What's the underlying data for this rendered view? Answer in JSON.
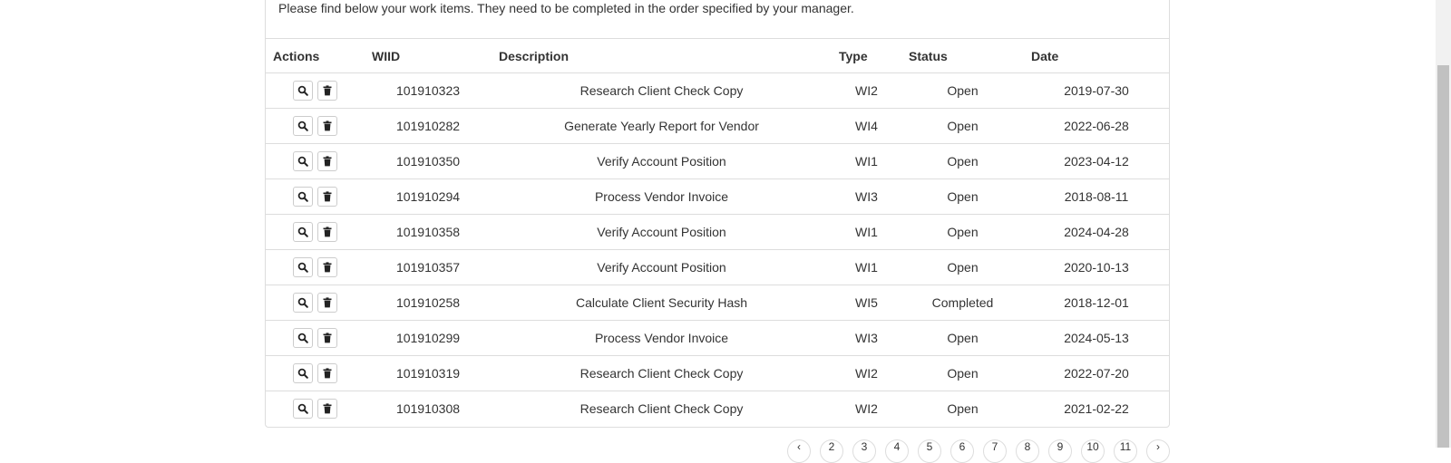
{
  "intro_text": "Please find below your work items. They need to be completed in the order specified by your manager.",
  "table": {
    "headers": [
      "Actions",
      "WIID",
      "Description",
      "Type",
      "Status",
      "Date"
    ],
    "rows": [
      {
        "wiid": "101910323",
        "description": "Research Client Check Copy",
        "type": "WI2",
        "status": "Open",
        "date": "2019-07-30"
      },
      {
        "wiid": "101910282",
        "description": "Generate Yearly Report for Vendor",
        "type": "WI4",
        "status": "Open",
        "date": "2022-06-28"
      },
      {
        "wiid": "101910350",
        "description": "Verify Account Position",
        "type": "WI1",
        "status": "Open",
        "date": "2023-04-12"
      },
      {
        "wiid": "101910294",
        "description": "Process Vendor Invoice",
        "type": "WI3",
        "status": "Open",
        "date": "2018-08-11"
      },
      {
        "wiid": "101910358",
        "description": "Verify Account Position",
        "type": "WI1",
        "status": "Open",
        "date": "2024-04-28"
      },
      {
        "wiid": "101910357",
        "description": "Verify Account Position",
        "type": "WI1",
        "status": "Open",
        "date": "2020-10-13"
      },
      {
        "wiid": "101910258",
        "description": "Calculate Client Security Hash",
        "type": "WI5",
        "status": "Completed",
        "date": "2018-12-01"
      },
      {
        "wiid": "101910299",
        "description": "Process Vendor Invoice",
        "type": "WI3",
        "status": "Open",
        "date": "2024-05-13"
      },
      {
        "wiid": "101910319",
        "description": "Research Client Check Copy",
        "type": "WI2",
        "status": "Open",
        "date": "2022-07-20"
      },
      {
        "wiid": "101910308",
        "description": "Research Client Check Copy",
        "type": "WI2",
        "status": "Open",
        "date": "2021-02-22"
      }
    ],
    "row_action_icons": [
      "search-icon",
      "trash-icon"
    ]
  },
  "pagination": {
    "items": [
      "‹",
      "2",
      "3",
      "4",
      "5",
      "6",
      "7",
      "8",
      "9",
      "10",
      "11",
      "›"
    ]
  }
}
